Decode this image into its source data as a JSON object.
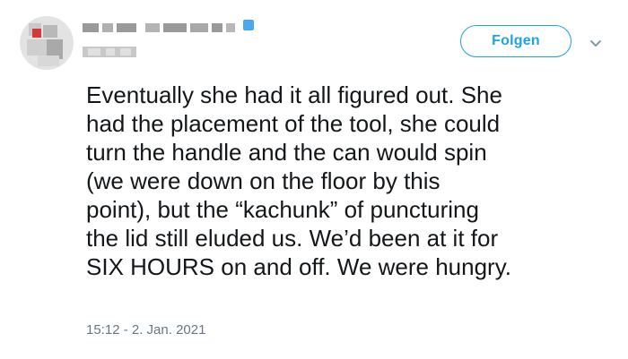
{
  "tweet": {
    "follow_label": "Folgen",
    "text_lines": [
      "Eventually she had it all figured out. She",
      "had the placement of the tool, she could",
      "turn the handle and the can would spin",
      "(we were down on the floor by this",
      "point), but the “kachunk” of puncturing",
      "the lid still eluded us. We’d been at it for",
      "SIX HOURS on and off. We were hungry."
    ],
    "timestamp": "15:12 - 2. Jan. 2021"
  },
  "icons": {
    "verified": "verified-badge-icon",
    "more": "chevron-down-icon"
  },
  "colors": {
    "accent": "#1da1f2",
    "text": "#14171a",
    "muted": "#657786"
  }
}
